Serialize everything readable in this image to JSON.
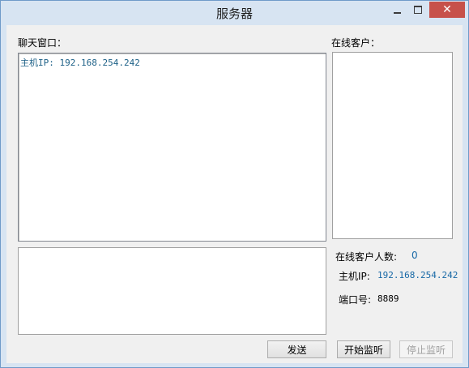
{
  "window": {
    "title": "服务器",
    "minimize_symbol": "minimize",
    "maximize_symbol": "maximize",
    "close_symbol": "✕"
  },
  "chat": {
    "label": "聊天窗口：",
    "lines": [
      "主机IP: 192.168.254.242"
    ]
  },
  "clients": {
    "label": "在线客户：",
    "items": []
  },
  "input": {
    "value": ""
  },
  "stats": {
    "count_label": "在线客户人数:",
    "count_value": "0",
    "host_label": "主机IP:",
    "host_value": "192.168.254.242",
    "port_label": "端口号:",
    "port_value": "8889"
  },
  "buttons": {
    "send": "发送",
    "start": "开始监听",
    "stop": "停止监听"
  },
  "colors": {
    "title_bar": "#d7e4f2",
    "close_button": "#c7514a",
    "accent_text": "#1768a6"
  }
}
